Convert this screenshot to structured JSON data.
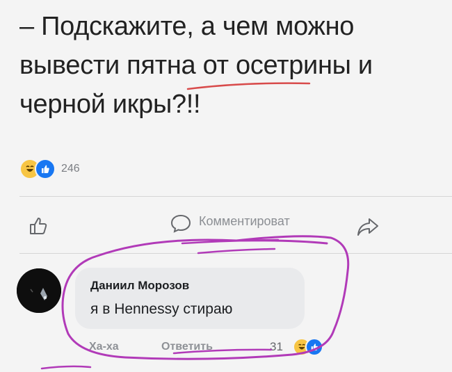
{
  "post": {
    "text_line1": "– Подскажите, а чем можно",
    "text_line2": "вывести пятна от осетрины и",
    "text_line3": "черной икры?!!"
  },
  "reactions": {
    "count": "246",
    "icons": [
      "haha-icon",
      "like-icon"
    ]
  },
  "actions": {
    "like_icon": "thumbs-up-outline-icon",
    "comment_icon": "comment-bubble-icon",
    "comment_label": "Комментироват",
    "share_icon": "share-arrow-icon"
  },
  "comment": {
    "author": "Даниил Морозов",
    "text": "я в Hennessy стираю",
    "haha_label": "Ха-ха",
    "reply_label": "Ответить",
    "reaction_count": "31"
  },
  "colors": {
    "annotation": "#b13ab8",
    "underline": "#d84b4b",
    "like_blue": "#1877f2",
    "haha_yellow": "#f7c544"
  }
}
